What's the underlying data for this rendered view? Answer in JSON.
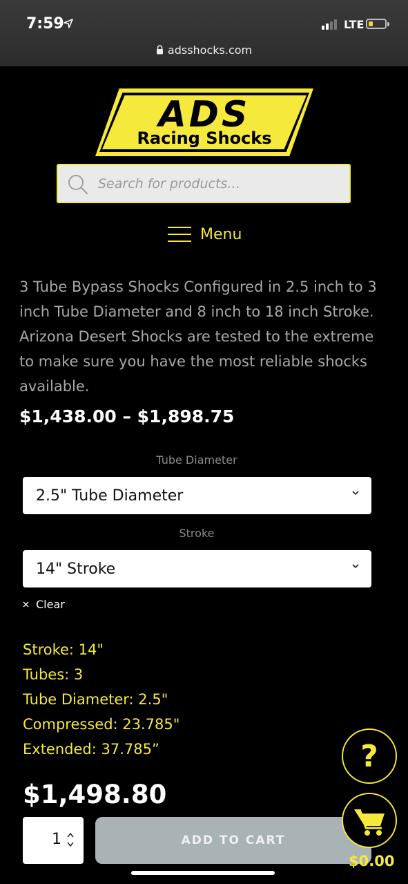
{
  "status_bar": {
    "time": "7:59",
    "network": "LTE",
    "url": "adsshocks.com"
  },
  "logo": {
    "main": "ADS",
    "sub": "Racing Shocks"
  },
  "search": {
    "placeholder": "Search for products…"
  },
  "menu": {
    "label": "Menu"
  },
  "product": {
    "description": "3 Tube Bypass Shocks Configured in 2.5 inch to 3 inch Tube Diameter and 8 inch to 18 inch Stroke. Arizona Desert Shocks are tested to the extreme to make sure you have the most reliable shocks available.",
    "price_range": "$1,438.00 – $1,898.75",
    "tube_diameter_label": "Tube Diameter",
    "tube_diameter_value": "2.5\" Tube Diameter",
    "stroke_label": "Stroke",
    "stroke_value": "14\" Stroke",
    "clear_label": "Clear",
    "specs": [
      "Stroke: 14\"",
      "Tubes: 3",
      "Tube Diameter: 2.5\"",
      "Compressed: 23.785\"",
      "Extended: 37.785”"
    ],
    "price": "$1,498.80",
    "quantity": "1",
    "add_to_cart_label": "ADD TO CART"
  },
  "floating": {
    "help_label": "?",
    "cart_total": "$0.00"
  },
  "colors": {
    "background": "#000000",
    "accent_yellow": "#f5e93c",
    "button_gray": "#a9b3b6"
  },
  "icons": [
    "location-arrow-icon",
    "signal-icon",
    "battery-icon",
    "lock-icon",
    "search-icon",
    "hamburger-icon",
    "chevron-down-icon",
    "close-icon",
    "stepper-icon",
    "question-icon",
    "cart-icon"
  ]
}
